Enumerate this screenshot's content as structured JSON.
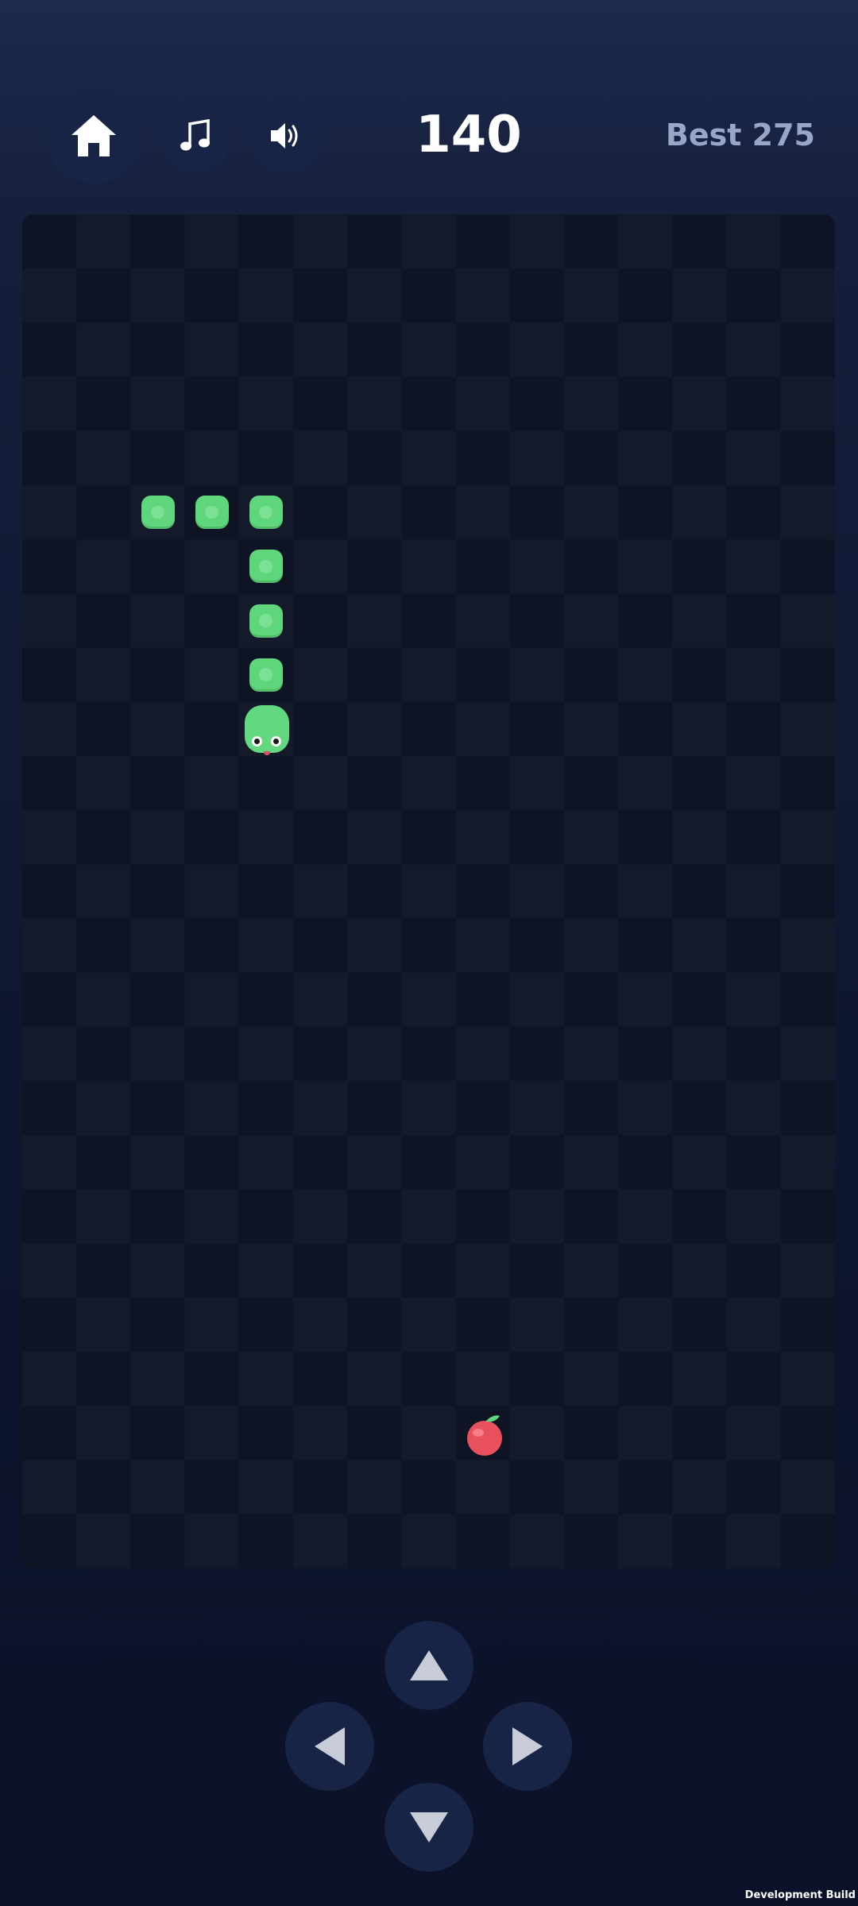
{
  "header": {
    "home_icon": "home-icon",
    "music_icon": "music-note-icon",
    "sound_icon": "speaker-volume-icon",
    "score": "140",
    "best_label": "Best 275"
  },
  "board": {
    "columns": 15,
    "rows": 25,
    "snake": {
      "color": "#5fd67c",
      "segments": [
        [
          2,
          5
        ],
        [
          3,
          5
        ],
        [
          4,
          5
        ],
        [
          4,
          6
        ],
        [
          4,
          7
        ],
        [
          4,
          8
        ]
      ],
      "head": [
        4,
        9
      ],
      "direction": "down"
    },
    "apple": {
      "cell": [
        8,
        22
      ],
      "color": "#e8505b"
    }
  },
  "controls": {
    "up_icon": "arrow-up-icon",
    "left_icon": "arrow-left-icon",
    "right_icon": "arrow-right-icon",
    "down_icon": "arrow-down-icon"
  },
  "footer": {
    "build_label": "Development Build"
  }
}
